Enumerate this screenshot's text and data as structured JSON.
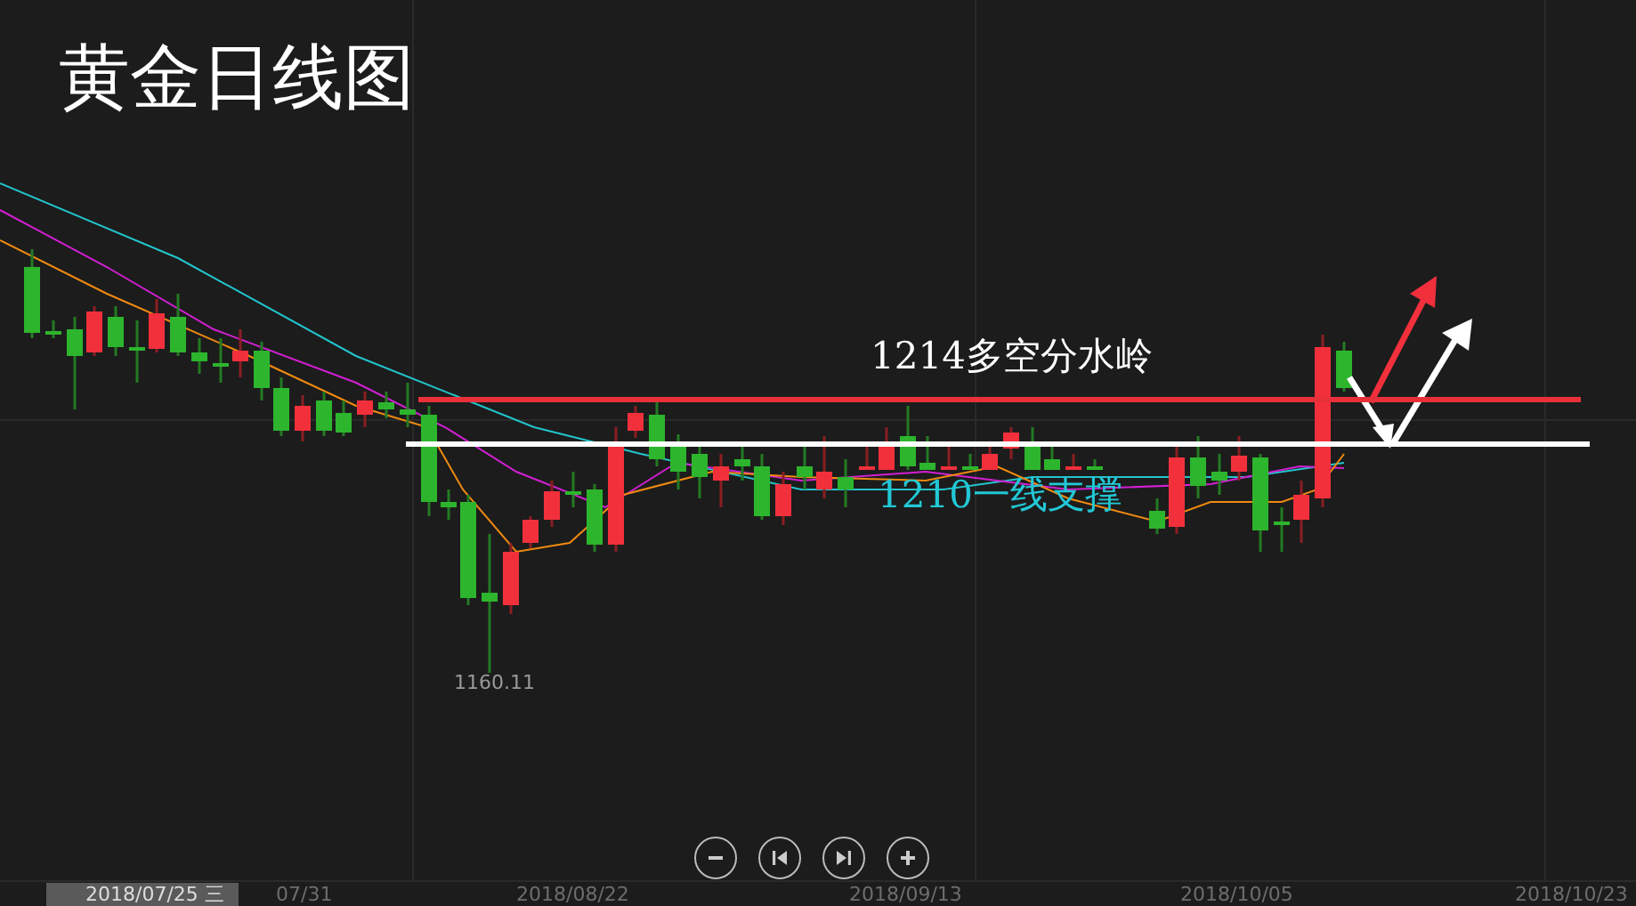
{
  "title": "黄金日线图",
  "levels": [
    {
      "kind": "resistance",
      "label": "1214多空分水岭",
      "color": "#e8303a"
    },
    {
      "kind": "support",
      "label": "1210一线支撑",
      "color": "#ffffff"
    }
  ],
  "low_label": "1160.11",
  "zoom_controls": [
    {
      "kind": "zoom-out"
    },
    {
      "kind": "step-back"
    },
    {
      "kind": "step-forward"
    },
    {
      "kind": "zoom-in"
    }
  ],
  "x_axis": {
    "cursor_label": "2018/07/25 三",
    "labels": [
      "07/31",
      "2018/08/22",
      "2018/09/13",
      "2018/10/05",
      "2018/10/23"
    ]
  }
}
